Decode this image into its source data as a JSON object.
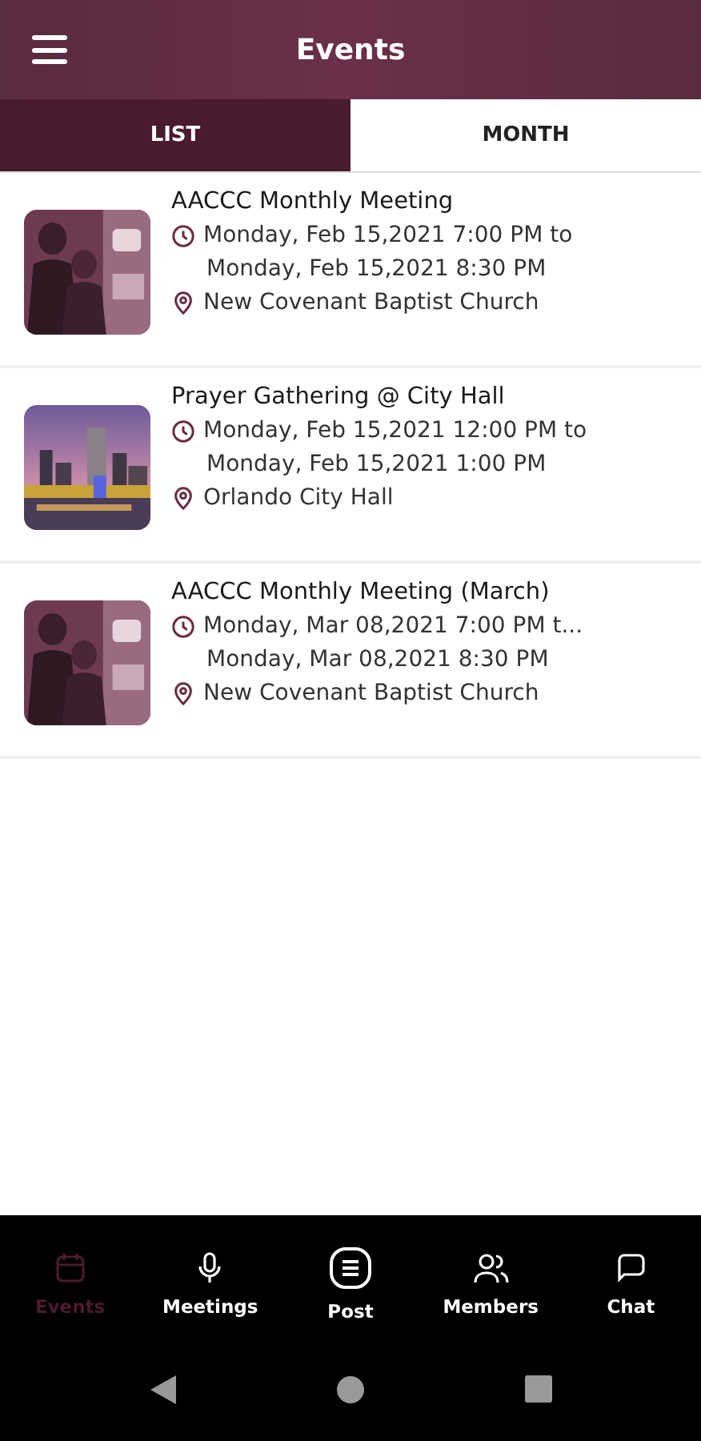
{
  "header": {
    "title": "Events"
  },
  "tabs": [
    {
      "label": "LIST",
      "selected": true
    },
    {
      "label": "MONTH",
      "selected": false
    }
  ],
  "events": [
    {
      "title": "AACCC Monthly Meeting",
      "start": "Monday, Feb 15,2021 7:00 PM to",
      "end": "Monday, Feb 15,2021 8:30 PM",
      "location": "New Covenant Baptist Church"
    },
    {
      "title": "Prayer Gathering @ City Hall",
      "start": "Monday, Feb 15,2021 12:00 PM to",
      "end": "Monday, Feb 15,2021 1:00 PM",
      "location": "Orlando City Hall"
    },
    {
      "title": "AACCC Monthly Meeting (March)",
      "start": "Monday, Mar 08,2021 7:00 PM t...",
      "end": "Monday, Mar 08,2021 8:30 PM",
      "location": "New Covenant Baptist Church"
    }
  ],
  "bottom_nav": [
    {
      "label": "Events",
      "selected": true
    },
    {
      "label": "Meetings",
      "selected": false
    },
    {
      "label": "Post",
      "selected": false
    },
    {
      "label": "Members",
      "selected": false
    },
    {
      "label": "Chat",
      "selected": false
    }
  ]
}
